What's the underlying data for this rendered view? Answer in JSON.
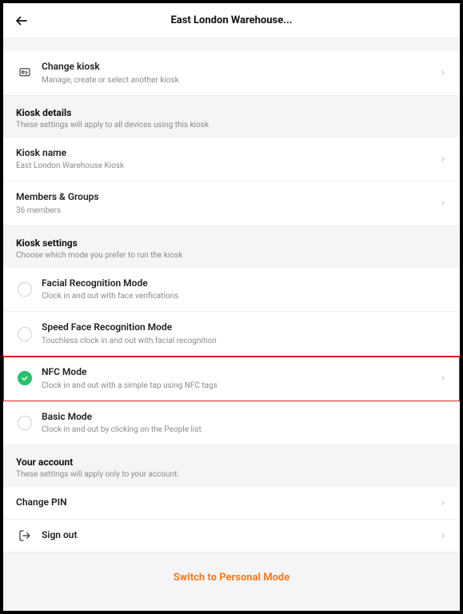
{
  "header": {
    "title": "East London Warehouse..."
  },
  "changeKiosk": {
    "title": "Change kiosk",
    "subtitle": "Manage, create or select another kiosk"
  },
  "kioskDetails": {
    "heading": "Kiosk details",
    "sub": "These settings will apply to all devices using this kiosk",
    "name": {
      "title": "Kiosk name",
      "subtitle": "East London Warehouse Kiosk"
    },
    "members": {
      "title": "Members & Groups",
      "subtitle": "36 members"
    }
  },
  "kioskSettings": {
    "heading": "Kiosk settings",
    "sub": "Choose which mode you prefer to run the kiosk",
    "modes": [
      {
        "title": "Facial Recognition Mode",
        "subtitle": "Clock in and out with face verifications"
      },
      {
        "title": "Speed Face Recognition Mode",
        "subtitle": "Touchless clock in and out with facial recognition"
      },
      {
        "title": "NFC Mode",
        "subtitle": "Clock in and out with a simple tap using NFC tags"
      },
      {
        "title": "Basic Mode",
        "subtitle": "Clock in and out by clicking on the People list"
      }
    ]
  },
  "account": {
    "heading": "Your account",
    "sub": "These settings will apply only to your account.",
    "changePin": "Change PIN",
    "signOut": "Sign out"
  },
  "footer": {
    "switch": "Switch to Personal Mode"
  }
}
